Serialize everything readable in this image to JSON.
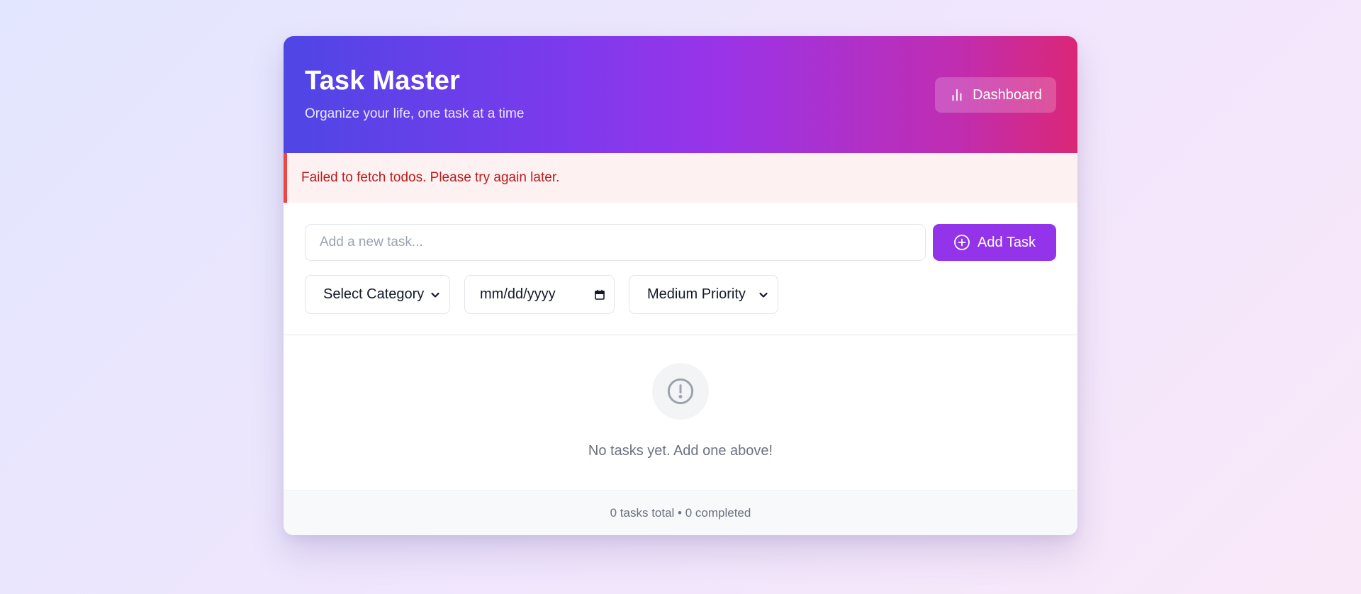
{
  "header": {
    "title": "Task Master",
    "subtitle": "Organize your life, one task at a time",
    "dashboard_label": "Dashboard",
    "dashboard_icon": "bar-chart-icon",
    "gradient": [
      "#4e46e5",
      "#7c3aed",
      "#db2777"
    ]
  },
  "error": {
    "message": "Failed to fetch todos. Please try again later.",
    "color": "#b91c1c",
    "border_color": "#ef4444"
  },
  "form": {
    "task_placeholder": "Add a new task...",
    "task_value": "",
    "add_label": "Add Task",
    "add_icon": "plus-circle-icon",
    "add_color": "#9333ea",
    "category": {
      "selected": "Select Category"
    },
    "due_date": {
      "value": "mm/dd/yyyy",
      "icon": "calendar-icon"
    },
    "priority": {
      "selected": "Medium Priority"
    }
  },
  "empty_state": {
    "icon": "alert-circle-icon",
    "message": "No tasks yet. Add one above!"
  },
  "footer": {
    "summary": "0 tasks total • 0 completed"
  }
}
